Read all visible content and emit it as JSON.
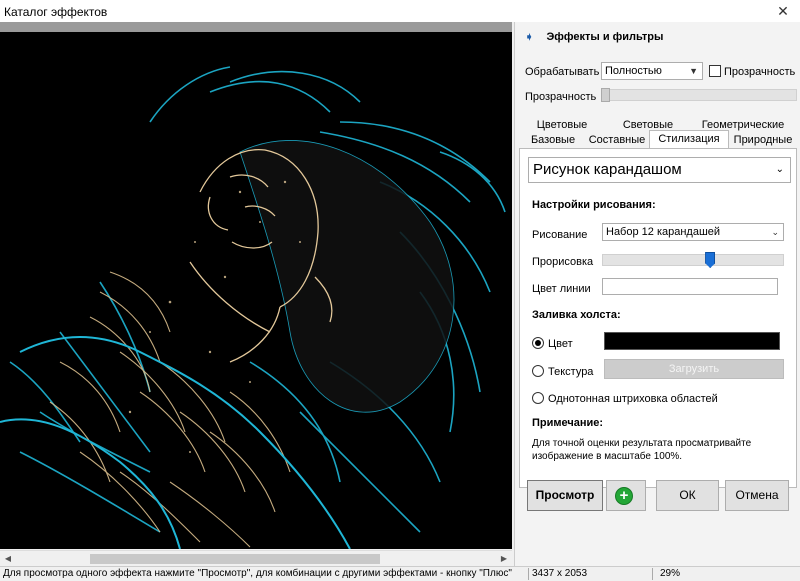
{
  "window": {
    "title": "Каталог эффектов",
    "close_glyph": "✕"
  },
  "preview": {
    "alt": "Изображение с эффектом «Рисунок карандашом»"
  },
  "header": {
    "title": "Эффекты и фильтры"
  },
  "process": {
    "label": "Обрабатывать",
    "value": "Полностью",
    "transparency_checkbox_label": "Прозрачность"
  },
  "transparency": {
    "label": "Прозрачность",
    "value": 0
  },
  "tabs": {
    "row1": [
      "Цветовые",
      "Световые",
      "Геометрические"
    ],
    "row2": [
      "Базовые",
      "Составные",
      "Стилизация",
      "Природные"
    ],
    "selected": "Стилизация"
  },
  "effect": {
    "selected": "Рисунок карандашом"
  },
  "drawing_settings": {
    "title": "Настройки рисования:",
    "drawing_label": "Рисование",
    "drawing_value": "Набор 12 карандашей",
    "detail_label": "Прорисовка",
    "detail_value": 0.6,
    "line_color_label": "Цвет линии",
    "line_color": "#ffffff"
  },
  "canvas_fill": {
    "title": "Заливка холста:",
    "color_label": "Цвет",
    "color_value": "#000000",
    "texture_label": "Текстура",
    "load_button": "Загрузить",
    "mono_label": "Однотонная штриховка областей",
    "selected": "Цвет"
  },
  "note": {
    "title": "Примечание:",
    "text": "Для точной оценки результата просматривайте изображение в масштабе 100%."
  },
  "buttons": {
    "preview": "Просмотр",
    "plus": "+",
    "ok": "ОК",
    "cancel": "Отмена"
  },
  "status": {
    "hint": "Для просмотра одного эффекта нажмите \"Просмотр\", для комбинации с другими эффектами - кнопку \"Плюс\"",
    "dimensions": "3437 x 2053",
    "zoom": "29%"
  },
  "colors": {
    "accent_blue": "#1a6fd6",
    "plus_green": "#23a636",
    "glow_cyan": "#1fb6d6",
    "sketch_beige": "#e3c89a"
  }
}
